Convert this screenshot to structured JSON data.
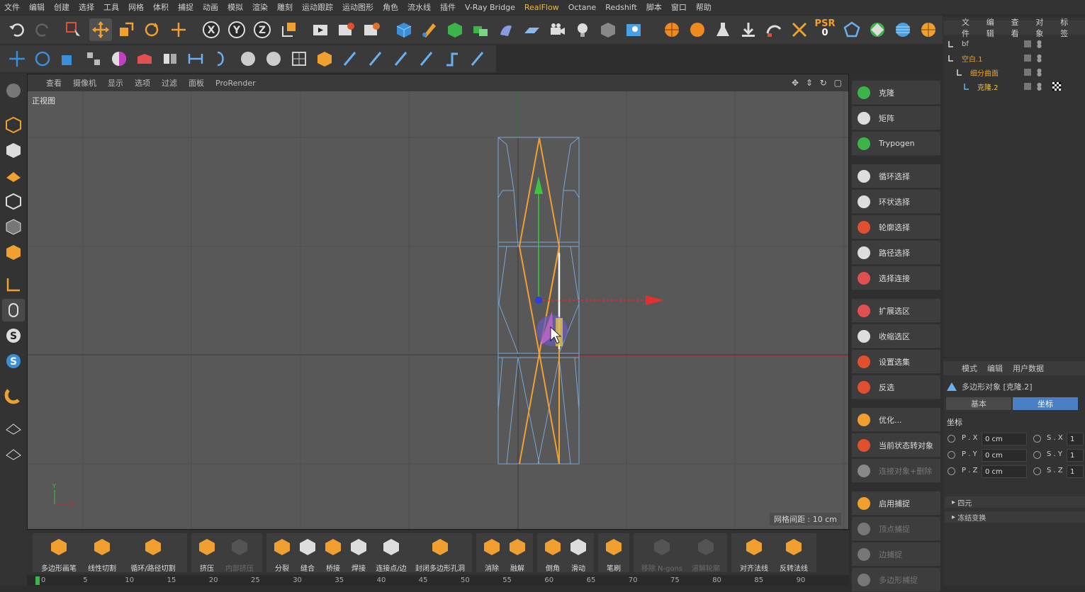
{
  "menu": [
    "文件",
    "编辑",
    "创建",
    "选择",
    "工具",
    "网格",
    "体积",
    "捕捉",
    "动画",
    "模拟",
    "渲染",
    "雕刻",
    "运动跟踪",
    "运动图形",
    "角色",
    "流水线",
    "插件",
    "V-Ray Bridge",
    "RealFlow",
    "Octane",
    "Redshift",
    "脚本",
    "窗口",
    "帮助"
  ],
  "menu_highlight": "RealFlow",
  "toolbar_top": {
    "psr_label": "PSR",
    "psr_value": "0"
  },
  "viewport": {
    "menu": [
      "查看",
      "摄像机",
      "显示",
      "选项",
      "过滤",
      "面板",
      "ProRender"
    ],
    "view_label": "正视图",
    "grid_spacing": "网格间距 : 10 cm"
  },
  "right_panel": {
    "group1": [
      "克隆",
      "矩阵",
      "Trypogen"
    ],
    "group2": [
      "循环选择",
      "环状选择",
      "轮廓选择",
      "路径选择",
      "选择连接"
    ],
    "group3": [
      "扩展选区",
      "收缩选区",
      "设置选集",
      "反选"
    ],
    "group4": [
      "优化...",
      "当前状态转对象",
      "连接对象+删除"
    ],
    "group5": [
      "启用捕捉",
      "顶点捕捉",
      "边捕捉",
      "多边形捕捉"
    ]
  },
  "object_manager": {
    "menu": [
      "文件",
      "编辑",
      "查看",
      "对象",
      "标签"
    ],
    "items": [
      {
        "name": "bf",
        "color": "#c8c8c8"
      },
      {
        "name": "空白.1",
        "color": "#e8a030"
      },
      {
        "name": "细分曲面",
        "color": "#e8a030"
      },
      {
        "name": "克隆.2",
        "color": "#f2c23a"
      }
    ]
  },
  "attributes": {
    "menu": [
      "模式",
      "编辑",
      "用户数据"
    ],
    "object_title": "多边形对象 [克隆.2]",
    "tabs": [
      "基本",
      "坐标"
    ],
    "active_tab": "坐标",
    "section": "坐标",
    "rows": [
      {
        "p_label": "P . X",
        "p_value": "0 cm",
        "s_label": "S . X",
        "s_value": "1"
      },
      {
        "p_label": "P . Y",
        "p_value": "0 cm",
        "s_label": "S . Y",
        "s_value": "1"
      },
      {
        "p_label": "P . Z",
        "p_value": "0 cm",
        "s_label": "S . Z",
        "s_value": "1"
      }
    ],
    "collapsed": [
      "四元",
      "冻结变换"
    ]
  },
  "bottom_tools": [
    "多边形画笔",
    "线性切割",
    "循环/路径切割",
    "挤压",
    "内部挤压",
    "分裂",
    "缝合",
    "桥接",
    "焊接",
    "连接点/边",
    "封闭多边形孔洞",
    "消除",
    "融解",
    "倒角",
    "滑动",
    "笔刷",
    "移除 N-gons",
    "溶解轮廓",
    "对齐法线",
    "反转法线"
  ],
  "timeline_ticks": [
    "0",
    "5",
    "10",
    "15",
    "20",
    "25",
    "30",
    "35",
    "40",
    "45",
    "50",
    "55",
    "60",
    "65",
    "70",
    "75",
    "80",
    "85",
    "90"
  ],
  "colors": {
    "accent_orange": "#f0a030",
    "accent_blue": "#3a8fd8",
    "active_tab": "#4a7fc6"
  }
}
